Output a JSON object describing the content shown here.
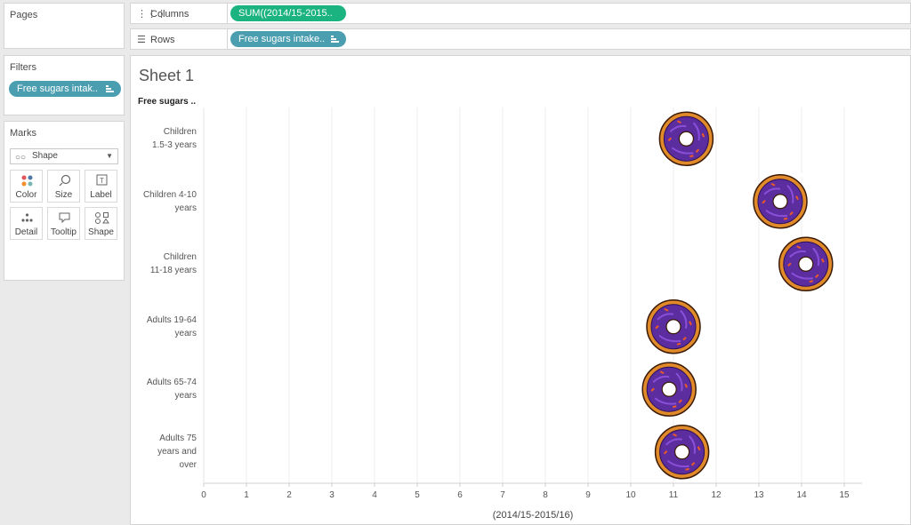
{
  "pages_card": {
    "title": "Pages"
  },
  "filters_card": {
    "title": "Filters",
    "pills": [
      {
        "label": "Free sugars intak.."
      }
    ]
  },
  "marks_card": {
    "title": "Marks",
    "mark_type": "Shape",
    "buttons": [
      {
        "label": "Color",
        "icon": "color-dots-icon"
      },
      {
        "label": "Size",
        "icon": "size-icon"
      },
      {
        "label": "Label",
        "icon": "label-icon"
      },
      {
        "label": "Detail",
        "icon": "detail-icon"
      },
      {
        "label": "Tooltip",
        "icon": "tooltip-icon"
      },
      {
        "label": "Shape",
        "icon": "shape-icon"
      }
    ]
  },
  "shelves": {
    "columns": {
      "label": "Columns",
      "pill": "SUM((2014/15-2015.."
    },
    "rows": {
      "label": "Rows",
      "pill": "Free sugars intake.."
    }
  },
  "sheet": {
    "title": "Sheet 1",
    "row_header": "Free sugars .."
  },
  "colors": {
    "pill_blue": "#4a9eb0",
    "pill_green": "#1bb380",
    "donut_icing": "#5b2d9e",
    "donut_dough": "#e08a2a"
  },
  "chart_data": {
    "type": "scatter",
    "mark": "custom-shape-donut",
    "categories": [
      "Children\n1.5-3 years",
      "Children 4-10\nyears",
      "Children\n11-18 years",
      "Adults 19-64\nyears",
      "Adults 65-74\nyears",
      "Adults 75\nyears and\nover"
    ],
    "values": [
      11.3,
      13.5,
      14.1,
      11.0,
      10.9,
      11.2
    ],
    "xlabel": "(2014/15-2015/16)",
    "xlim": [
      0,
      15
    ],
    "xticks": [
      "0",
      "1",
      "2",
      "3",
      "4",
      "5",
      "6",
      "7",
      "8",
      "9",
      "10",
      "11",
      "12",
      "13",
      "14",
      "15"
    ],
    "grid": true
  }
}
